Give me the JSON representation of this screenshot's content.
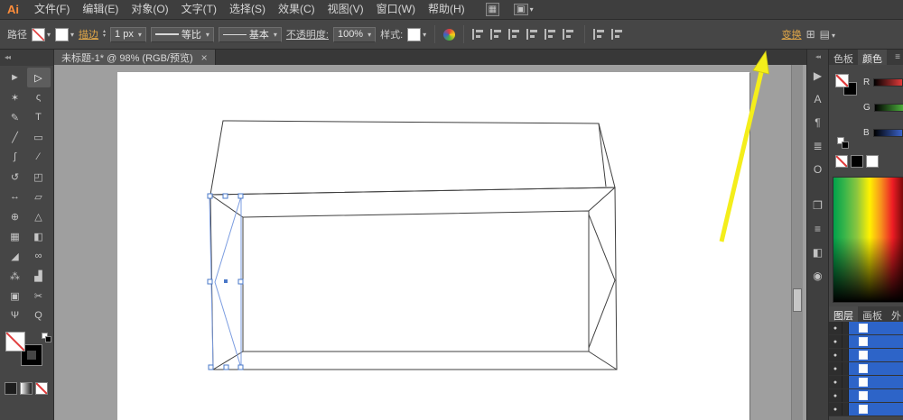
{
  "menubar": {
    "logo": "Ai",
    "items": [
      "文件(F)",
      "编辑(E)",
      "对象(O)",
      "文字(T)",
      "选择(S)",
      "效果(C)",
      "视图(V)",
      "窗口(W)",
      "帮助(H)"
    ],
    "icons": [
      {
        "name": "arrange-documents-icon",
        "glyph": "▦"
      },
      {
        "name": "workspace-switcher-icon",
        "glyph": "▣"
      }
    ],
    "caret": "▾"
  },
  "controlbar": {
    "context_label": "路径",
    "stroke_link": "描边",
    "stepper_up": "▴",
    "stepper_down": "▾",
    "stroke_width_value": "1 px",
    "caret": "▾",
    "profile_value": "等比",
    "brush_value": "基本",
    "opacity_link": "不透明度:",
    "opacity_value": "100%",
    "style_label": "样式:",
    "transform_link": "变换",
    "grid_icon": "⊞",
    "menu_icon": "▤"
  },
  "tabbar": {
    "title": "未标题-1* @ 98% (RGB/预览)",
    "close_icon": "×"
  },
  "tool_panel": {
    "collapse_icon": "◂◂",
    "tools": [
      {
        "name": "selection-tool",
        "glyph": "►"
      },
      {
        "name": "direct-selection-tool",
        "glyph": "▷"
      },
      {
        "name": "magic-wand-tool",
        "glyph": "✶"
      },
      {
        "name": "lasso-tool",
        "glyph": "ς"
      },
      {
        "name": "pen-tool",
        "glyph": "✎"
      },
      {
        "name": "type-tool",
        "glyph": "T"
      },
      {
        "name": "line-segment-tool",
        "glyph": "╱"
      },
      {
        "name": "rectangle-tool",
        "glyph": "▭"
      },
      {
        "name": "paintbrush-tool",
        "glyph": "∫"
      },
      {
        "name": "pencil-tool",
        "glyph": "⁄"
      },
      {
        "name": "rotate-tool",
        "glyph": "↺"
      },
      {
        "name": "scale-tool",
        "glyph": "◰"
      },
      {
        "name": "width-tool",
        "glyph": "↔"
      },
      {
        "name": "free-transform-tool",
        "glyph": "▱"
      },
      {
        "name": "shape-builder-tool",
        "glyph": "⊕"
      },
      {
        "name": "perspective-grid-tool",
        "glyph": "△"
      },
      {
        "name": "mesh-tool",
        "glyph": "▦"
      },
      {
        "name": "gradient-tool",
        "glyph": "◧"
      },
      {
        "name": "eyedropper-tool",
        "glyph": "◢"
      },
      {
        "name": "blend-tool",
        "glyph": "∞"
      },
      {
        "name": "symbol-sprayer-tool",
        "glyph": "⁂"
      },
      {
        "name": "column-graph-tool",
        "glyph": "▟"
      },
      {
        "name": "artboard-tool",
        "glyph": "▣"
      },
      {
        "name": "slice-tool",
        "glyph": "✂"
      },
      {
        "name": "hand-tool",
        "glyph": "Ψ"
      },
      {
        "name": "zoom-tool",
        "glyph": "Q"
      }
    ]
  },
  "right_strip": {
    "collapse_icon": "◂◂",
    "icons": [
      {
        "name": "flow-panel-icon",
        "glyph": "▶"
      },
      {
        "name": "character-panel-icon",
        "glyph": "A"
      },
      {
        "name": "paragraph-panel-icon",
        "glyph": "¶"
      },
      {
        "name": "glyphs-panel-icon",
        "glyph": "≣"
      },
      {
        "name": "opentype-panel-icon",
        "glyph": "O"
      },
      {
        "name": "appearance-panel-icon",
        "glyph": "❐"
      },
      {
        "name": "graphic-styles-panel-icon",
        "glyph": "≡"
      },
      {
        "name": "gradient-panel-icon",
        "glyph": "◧"
      },
      {
        "name": "symbols-panel-icon",
        "glyph": "◉"
      }
    ]
  },
  "color_panel": {
    "tabs": [
      "色板",
      "颜色"
    ],
    "menu_icon": "≡",
    "channels": [
      "R",
      "G",
      "B"
    ]
  },
  "layers_panel": {
    "tabs": [
      "图层",
      "画板",
      "外"
    ],
    "eye_icon": "●"
  }
}
